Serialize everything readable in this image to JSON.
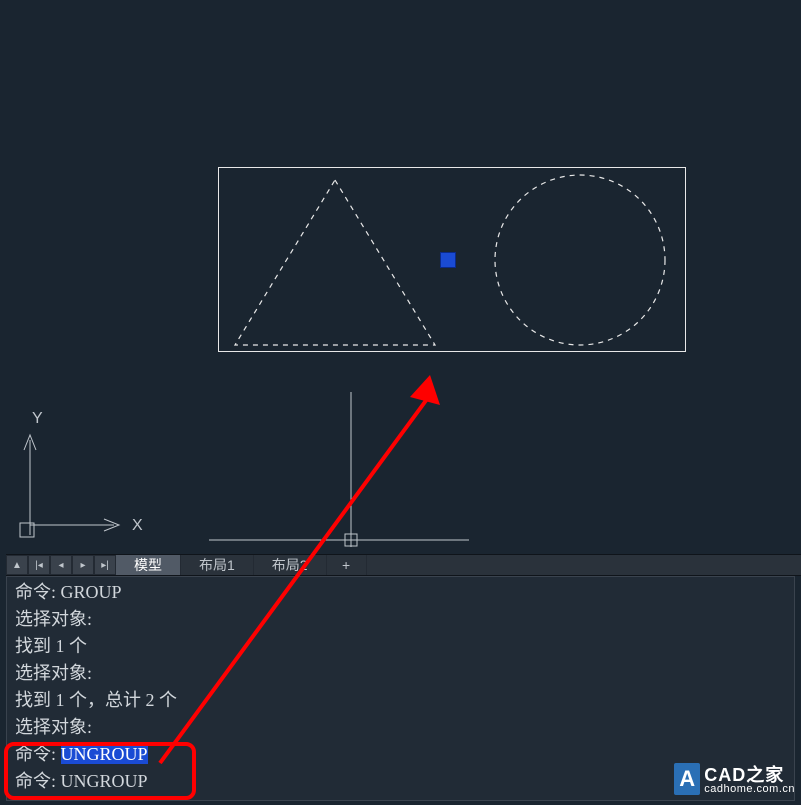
{
  "tabs": {
    "model": "模型",
    "layout1": "布局1",
    "layout2": "布局2",
    "plus": "+"
  },
  "ucs": {
    "x": "X",
    "y": "Y"
  },
  "cmd": {
    "l1": "命令: GROUP",
    "l2": "选择对象:",
    "l3": "找到 1 个",
    "l4": "选择对象:",
    "l5": "找到 1 个，总计 2 个",
    "l6": "选择对象:",
    "l7_prefix": "命令: ",
    "l7_sel": "UNGROUP",
    "l8": "命令: UNGROUP"
  },
  "watermark": {
    "badge": "A",
    "title": "CAD之家",
    "url": "cadhome.com.cn"
  }
}
